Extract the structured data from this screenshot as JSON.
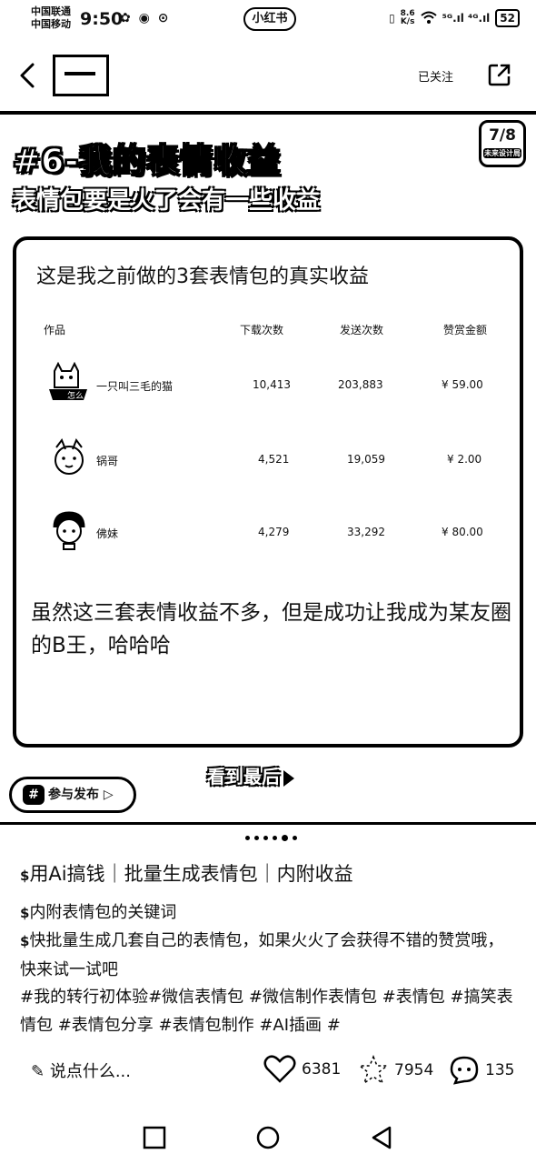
{
  "status_bar": {
    "carrier_1": "中国联通",
    "carrier_2": "中国移动",
    "time": "9:50",
    "left_icons": "✿ ◉ ⊙",
    "app_badge": "小红书",
    "net_speed_value": "8.6",
    "net_speed_unit": "K/s",
    "signal_text": "⁵ᴳ.ıl ⁴ᴳ.ıl",
    "battery": "52"
  },
  "header": {
    "follow_label": "已关注"
  },
  "post_image": {
    "title": "#6-我的表情收益",
    "subtitle": "表情包要是火了会有一些收益",
    "page_number": "7/8",
    "page_tag": "未来设计局",
    "card_heading": "这是我之前做的3套表情包的真实收益",
    "table_headers": [
      "作品",
      "下载次数",
      "发送次数",
      "赞赏金额"
    ],
    "rows": [
      {
        "name": "一只叫三毛的猫",
        "downloads": "10,413",
        "sends": "203,883",
        "amount": "¥ 59.00"
      },
      {
        "name": "锅哥",
        "downloads": "4,521",
        "sends": "19,059",
        "amount": "¥ 2.00"
      },
      {
        "name": "佛妹",
        "downloads": "4,279",
        "sends": "33,292",
        "amount": "¥ 80.00"
      }
    ],
    "card_paragraph": "虽然这三套表情收益不多，但是成功让我成为某友圈的B王，哈哈哈",
    "watch_last": "看到最后",
    "join_label": "参与发布",
    "join_hash": "#"
  },
  "description": {
    "line1_icon": "$",
    "line1": "用Ai搞钱｜批量生成表情包｜内附收益",
    "line2_icon": "$",
    "line2": "内附表情包的关键词",
    "line3_icon": "$",
    "line3": "快批量生成几套自己的表情包，如果火火了会获得不错的赞赏哦，快来试一试吧",
    "tags": "#我的转行初体验#微信表情包 #微信制作表情包 #表情包 #搞笑表情包 #表情包分享 #表情包制作 #AI插画 #"
  },
  "actions": {
    "comment_placeholder": "说点什么...",
    "likes": "6381",
    "stars": "7954",
    "comments": "135"
  }
}
